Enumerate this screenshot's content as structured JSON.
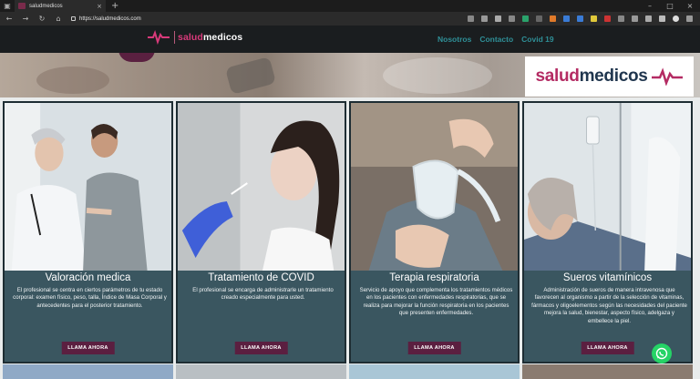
{
  "browser": {
    "tab_title": "saludmedicos",
    "new_tab": "+",
    "url": "https://saludmedicos.com"
  },
  "site": {
    "logo_text_1": "salud",
    "logo_text_2": "medicos",
    "menu": [
      "Nosotros",
      "Contacto",
      "Covid 19"
    ],
    "banner_logo_1": "salud",
    "banner_logo_2": "medicos"
  },
  "cards": [
    {
      "title": "Valoración medica",
      "desc": "El profesional se centra en ciertos parámetros de tu estado corporal: examen físico, peso, talla, Índice de Masa Corporal y antecedentes para el posterior tratamiento.",
      "button": "LLAMA AHORA"
    },
    {
      "title": "Tratamiento de COVID",
      "desc": "El profesional se encarga de administrarle un tratamiento creado especialmente para usted.",
      "button": "LLAMA AHORA"
    },
    {
      "title": "Terapia respiratoria",
      "desc": "Servicio de apoyo que complementa los tratamientos médicos en los pacientes con enfermedades respiratorias, que se realiza para mejorar la función respiratoria en los pacientes que presenten enfermedades.",
      "button": "LLAMA AHORA"
    },
    {
      "title": "Sueros vitamínicos",
      "desc": "Administración de sueros de manera intravenosa que favorecen al organismo a partir de la selección de vitaminas, fármacos y oligoelementos según las necesidades del paciente mejora la salud, bienestar, aspecto físico, adelgaza y embellece la piel.",
      "button": "LLAMA AHORA"
    }
  ],
  "colors": {
    "card_bg": "#3a5660",
    "button_bg": "#5b1f40",
    "menu_link": "#2f8f97",
    "brand_pink": "#b42b63"
  }
}
